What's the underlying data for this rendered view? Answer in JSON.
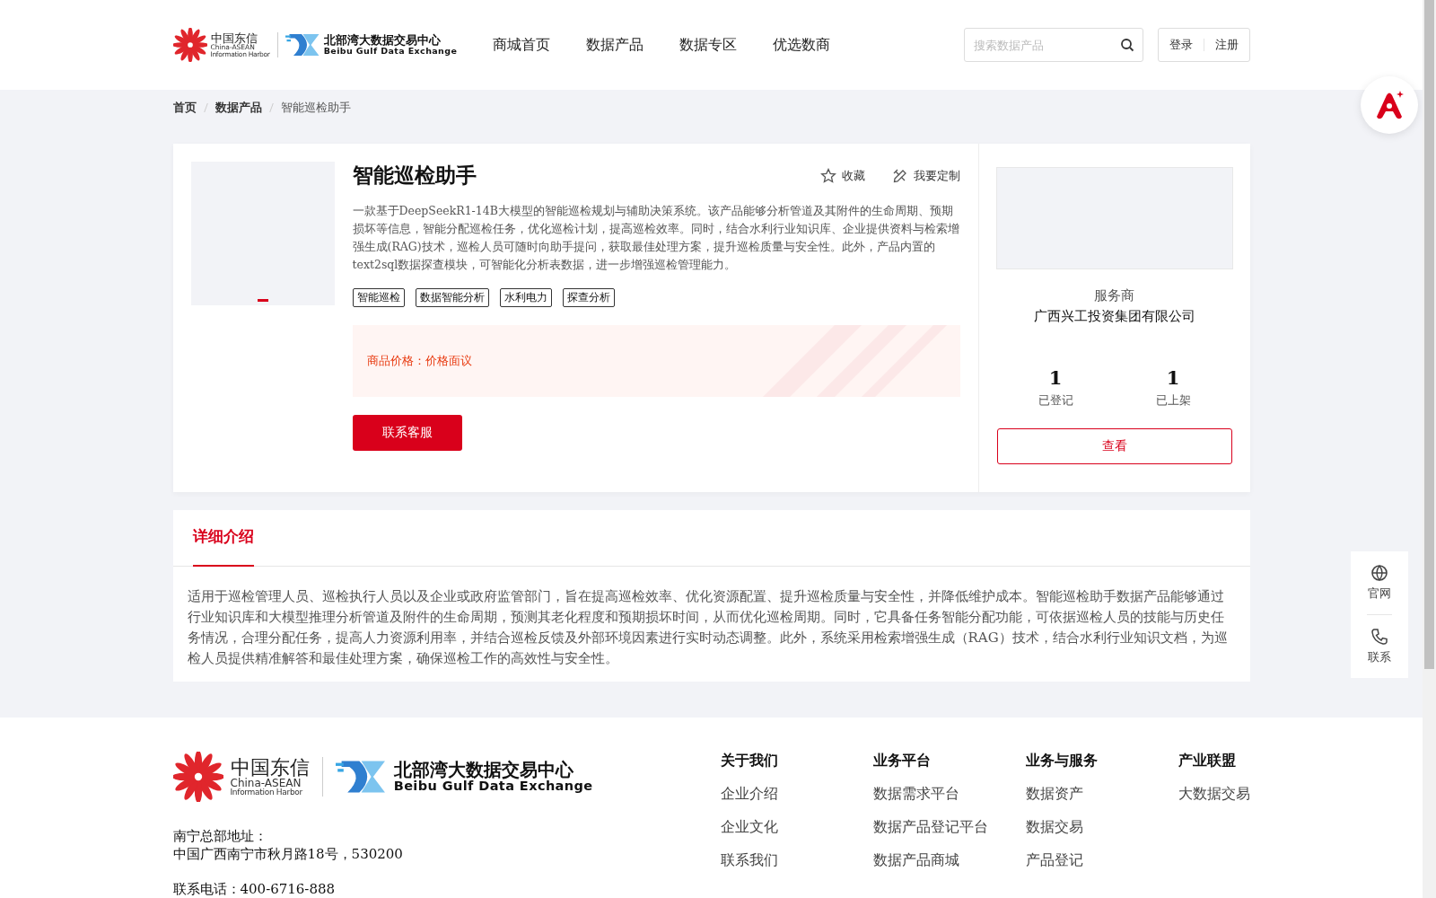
{
  "logo": {
    "cn": "中国东信",
    "en1": "China-ASEAN",
    "en2": "Information Harbor",
    "cn2": "北部湾大数据交易中心",
    "en3": "Beibu Gulf Data Exchange"
  },
  "footer_logo": {
    "cn": "中国东信",
    "en1": "China-ASEAN",
    "en2": "Information Harbor",
    "cn2": "北部湾大数据交易中心",
    "en3": "Beibu Gulf Data Exchange"
  },
  "nav": [
    {
      "label": "商城首页",
      "selected": false
    },
    {
      "label": "数据产品",
      "selected": false
    },
    {
      "label": "数据专区",
      "selected": false
    },
    {
      "label": "优选数商",
      "selected": false
    }
  ],
  "search": {
    "placeholder": "搜索数据产品"
  },
  "auth": [
    "登录",
    "注册"
  ],
  "breadcrumb": [
    "首页",
    "数据产品",
    "智能巡检助手"
  ],
  "product": {
    "title": "智能巡检助手",
    "actions": [
      {
        "kind": "star",
        "label": "收藏"
      },
      {
        "kind": "custom",
        "label": "我要定制"
      }
    ],
    "description": "一款基于DeepSeekR1-14B大模型的智能巡检规划与辅助决策系统。该产品能够分析管道及其附件的生命周期、预期损坏等信息，智能分配巡检任务，优化巡检计划，提高巡检效率。同时，结合水利行业知识库、企业提供资料与检索增强生成(RAG)技术，巡检人员可随时向助手提问，获取最佳处理方案，提升巡检质量与安全性。此外，产品内置的text2sql数据探查模块，可智能化分析表数据，进一步增强巡检管理能力。",
    "tags": [
      "智能巡检",
      "数据智能分析",
      "水利电力",
      "探查分析"
    ],
    "price_label": "商品价格：",
    "price": "价格面议",
    "contact_button": "联系客服",
    "image_dots": [
      {
        "selected": true
      }
    ]
  },
  "provider": {
    "label": "服务商",
    "name": "广西兴工投资集团有限公司",
    "stats": [
      {
        "value": "1",
        "label": "已登记"
      },
      {
        "value": "1",
        "label": "已上架"
      }
    ],
    "button": "查看"
  },
  "detail": {
    "tabs": [
      {
        "label": "详细介绍",
        "selected": true
      }
    ],
    "text": "适用于巡检管理人员、巡检执行人员以及企业或政府监管部门，旨在提高巡检效率、优化资源配置、提升巡检质量与安全性，并降低维护成本。智能巡检助手数据产品能够通过行业知识库和大模型推理分析管道及附件的生命周期，预测其老化程度和预期损坏时间，从而优化巡检周期。同时，它具备任务智能分配功能，可依据巡检人员的技能与历史任务情况，合理分配任务，提高人力资源利用率，并结合巡检反馈及外部环境因素进行实时动态调整。此外，系统采用检索增强生成（RAG）技术，结合水利行业知识文档，为巡检人员提供精准解答和最佳处理方案，确保巡检工作的高效性与安全性。"
  },
  "side_tools": [
    {
      "kind": "globe",
      "label": "官网"
    },
    {
      "kind": "phone",
      "label": "联系"
    }
  ],
  "footer": {
    "address_label": "南宁总部地址：",
    "address": "中国广西南宁市秋月路18号，530200",
    "phone": "联系电话：400-6716-888",
    "columns": [
      {
        "title": "关于我们",
        "links": [
          "企业介绍",
          "企业文化",
          "联系我们"
        ]
      },
      {
        "title": "业务平台",
        "links": [
          "数据需求平台",
          "数据产品登记平台",
          "数据产品商城"
        ]
      },
      {
        "title": "业务与服务",
        "links": [
          "数据资产",
          "数据交易",
          "产品登记"
        ]
      },
      {
        "title": "产业联盟",
        "links": [
          "大数据交易"
        ]
      }
    ]
  }
}
